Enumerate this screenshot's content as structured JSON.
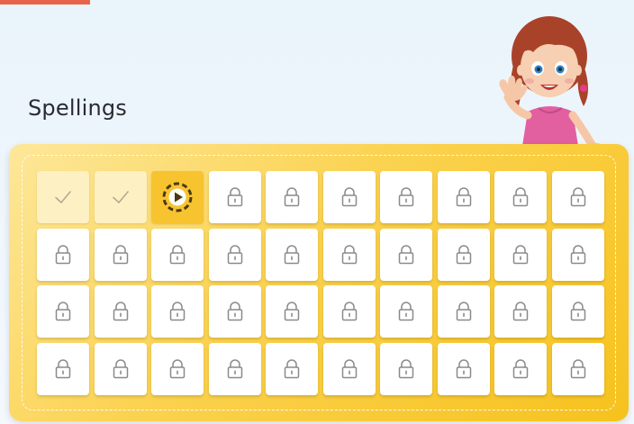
{
  "page": {
    "title": "Spellings"
  },
  "colors": {
    "accent": "#e8644a",
    "board": "#f6c21d",
    "current": "#f7c430",
    "done": "#fdf0c2"
  },
  "levels": [
    {
      "state": "done",
      "icon": "check-icon"
    },
    {
      "state": "done",
      "icon": "check-icon"
    },
    {
      "state": "current",
      "icon": "play-icon"
    },
    {
      "state": "locked",
      "icon": "lock-icon"
    },
    {
      "state": "locked",
      "icon": "lock-icon"
    },
    {
      "state": "locked",
      "icon": "lock-icon"
    },
    {
      "state": "locked",
      "icon": "lock-icon"
    },
    {
      "state": "locked",
      "icon": "lock-icon"
    },
    {
      "state": "locked",
      "icon": "lock-icon"
    },
    {
      "state": "locked",
      "icon": "lock-icon"
    },
    {
      "state": "locked",
      "icon": "lock-icon"
    },
    {
      "state": "locked",
      "icon": "lock-icon"
    },
    {
      "state": "locked",
      "icon": "lock-icon"
    },
    {
      "state": "locked",
      "icon": "lock-icon"
    },
    {
      "state": "locked",
      "icon": "lock-icon"
    },
    {
      "state": "locked",
      "icon": "lock-icon"
    },
    {
      "state": "locked",
      "icon": "lock-icon"
    },
    {
      "state": "locked",
      "icon": "lock-icon"
    },
    {
      "state": "locked",
      "icon": "lock-icon"
    },
    {
      "state": "locked",
      "icon": "lock-icon"
    },
    {
      "state": "locked",
      "icon": "lock-icon"
    },
    {
      "state": "locked",
      "icon": "lock-icon"
    },
    {
      "state": "locked",
      "icon": "lock-icon"
    },
    {
      "state": "locked",
      "icon": "lock-icon"
    },
    {
      "state": "locked",
      "icon": "lock-icon"
    },
    {
      "state": "locked",
      "icon": "lock-icon"
    },
    {
      "state": "locked",
      "icon": "lock-icon"
    },
    {
      "state": "locked",
      "icon": "lock-icon"
    },
    {
      "state": "locked",
      "icon": "lock-icon"
    },
    {
      "state": "locked",
      "icon": "lock-icon"
    },
    {
      "state": "locked",
      "icon": "lock-icon"
    },
    {
      "state": "locked",
      "icon": "lock-icon"
    },
    {
      "state": "locked",
      "icon": "lock-icon"
    },
    {
      "state": "locked",
      "icon": "lock-icon"
    },
    {
      "state": "locked",
      "icon": "lock-icon"
    },
    {
      "state": "locked",
      "icon": "lock-icon"
    },
    {
      "state": "locked",
      "icon": "lock-icon"
    },
    {
      "state": "locked",
      "icon": "lock-icon"
    },
    {
      "state": "locked",
      "icon": "lock-icon"
    },
    {
      "state": "locked",
      "icon": "lock-icon"
    }
  ]
}
